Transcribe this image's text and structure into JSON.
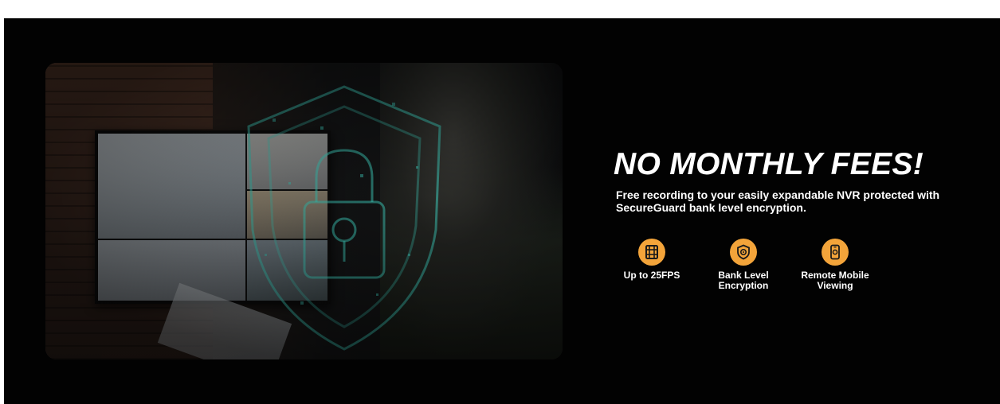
{
  "banner": {
    "headline": "NO MONTHLY FEES!",
    "subtext": "Free recording to your easily expandable NVR protected with SecureGuard bank level encryption.",
    "accent_color": "#f3a43a",
    "background_color": "#020202"
  },
  "hero_image": {
    "alt_icon": "padlock-shield-icon"
  },
  "features": [
    {
      "icon": "film-strip-icon",
      "label": "Up to 25FPS"
    },
    {
      "icon": "shield-lock-icon",
      "label": "Bank Level Encryption"
    },
    {
      "icon": "mobile-phone-icon",
      "label": "Remote Mobile Viewing"
    }
  ]
}
